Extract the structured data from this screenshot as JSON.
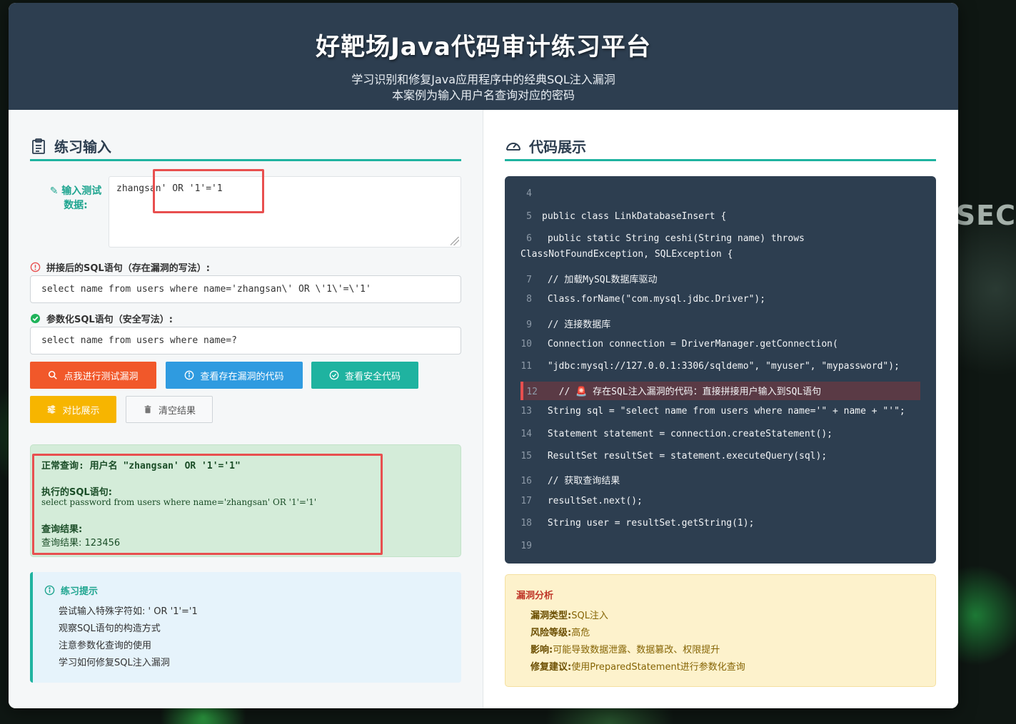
{
  "header": {
    "title": "好靶场Java代码审计练习平台",
    "subtitle1": "学习识别和修复Java应用程序中的经典SQL注入漏洞",
    "subtitle2": "本案例为输入用户名查询对应的密码"
  },
  "left": {
    "title": "练习输入",
    "input_label": "输入测试数据:",
    "input_value": "zhangsan' OR '1'='1",
    "concat_label": "拼接后的SQL语句（存在漏洞的写法）:",
    "concat_sql": "select name from users where name='zhangsan\\' OR \\'1\\'=\\'1'",
    "param_label": "参数化SQL语句（安全写法）:",
    "param_sql": "select name from users where name=?",
    "buttons": {
      "test": "点我进行测试漏洞",
      "vuln_code": "查看存在漏洞的代码",
      "safe_code": "查看安全代码",
      "compare": "对比展示",
      "clear": "清空结果"
    },
    "result": {
      "normal_query": "正常查询: 用户名 \"zhangsan' OR '1'='1\"",
      "executed_label": "执行的SQL语句:",
      "executed_sql": "select password from users where name='zhangsan' OR '1'='1'",
      "result_label": "查询结果:",
      "result_value": "查询结果: 123456"
    },
    "tips": {
      "title": "练习提示",
      "items": [
        "尝试输入特殊字符如: ' OR '1'='1",
        "观察SQL语句的构造方式",
        "注意参数化查询的使用",
        "学习如何修复SQL注入漏洞"
      ]
    }
  },
  "right": {
    "title": "代码展示",
    "code_lines": [
      {
        "n": "4",
        "t": ""
      },
      {
        "n": "5",
        "t": "public class LinkDatabaseInsert {"
      },
      {
        "n": "6",
        "t": " public static String ceshi(String name) throws"
      },
      {
        "n": "",
        "t": "ClassNotFoundException, SQLException {"
      },
      {
        "n": "7",
        "t": " // 加载MySQL数据库驱动"
      },
      {
        "n": "8",
        "t": " Class.forName(\"com.mysql.jdbc.Driver\");"
      },
      {
        "n": "9",
        "t": " // 连接数据库"
      },
      {
        "n": "10",
        "t": " Connection connection = DriverManager.getConnection("
      },
      {
        "n": "11",
        "t": " \"jdbc:mysql://127.0.0.1:3306/sqldemo\", \"myuser\", \"mypassword\");"
      },
      {
        "n": "12",
        "t": "  // 🚨 存在SQL注入漏洞的代码：直接拼接用户输入到SQL语句"
      },
      {
        "n": "13",
        "t": " String sql = \"select name from users where name='\" + name + \"'\";"
      },
      {
        "n": "14",
        "t": " Statement statement = connection.createStatement();"
      },
      {
        "n": "15",
        "t": " ResultSet resultSet = statement.executeQuery(sql);"
      },
      {
        "n": "16",
        "t": " // 获取查询结果"
      },
      {
        "n": "17",
        "t": " resultSet.next();"
      },
      {
        "n": "18",
        "t": " String user = resultSet.getString(1);"
      },
      {
        "n": "19",
        "t": ""
      }
    ],
    "analysis": {
      "title": "漏洞分析",
      "type_label": "漏洞类型:",
      "type_value": "SQL注入",
      "risk_label": "风险等级:",
      "risk_value": "高危",
      "impact_label": "影响:",
      "impact_value": "可能导致数据泄露、数据篡改、权限提升",
      "fix_label": "修复建议:",
      "fix_value": "使用PreparedStatement进行参数化查询"
    }
  },
  "background_text": "SEC",
  "colors": {
    "header": "#2d3e50",
    "accent": "#1fb3a0",
    "btn_test": "#f1582a",
    "btn_vuln": "#2f9be0",
    "btn_safe": "#1fb3a0",
    "btn_compare": "#f7b500",
    "highlight": "#e84f4f"
  }
}
